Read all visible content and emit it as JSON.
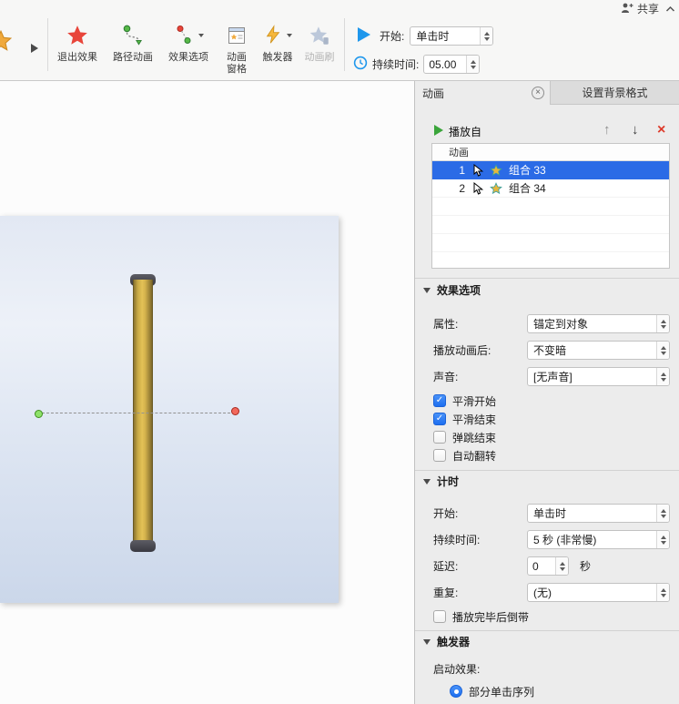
{
  "titlebar": {
    "share": "共享"
  },
  "ribbon": {
    "buttons": {
      "exit_effect": "退出效果",
      "path_animation": "路径动画",
      "effect_options": "效果选项",
      "animation_pane_line1": "动画",
      "animation_pane_line2": "窗格",
      "trigger": "触发器",
      "animation_painter": "动画刷"
    },
    "start_label": "开始:",
    "start_value": "单击时",
    "duration_label": "持续时间:",
    "duration_value": "05.00"
  },
  "panel": {
    "tab_animation": "动画",
    "tab_background": "设置背景格式",
    "play_from": "播放自",
    "list_header": "动画",
    "rows": [
      {
        "index": "1",
        "label": "组合 33",
        "selected": true
      },
      {
        "index": "2",
        "label": "组合 34",
        "selected": false
      }
    ],
    "effect": {
      "title": "效果选项",
      "property_label": "属性:",
      "property_value": "锚定到对象",
      "after_label": "播放动画后:",
      "after_value": "不变暗",
      "sound_label": "声音:",
      "sound_value": "[无声音]",
      "smooth_start": {
        "label": "平滑开始",
        "checked": true
      },
      "smooth_end": {
        "label": "平滑结束",
        "checked": true
      },
      "bounce_end": {
        "label": "弹跳结束",
        "checked": false
      },
      "auto_reverse": {
        "label": "自动翻转",
        "checked": false
      }
    },
    "timing": {
      "title": "计时",
      "start_label": "开始:",
      "start_value": "单击时",
      "duration_label": "持续时间:",
      "duration_value": "5 秒 (非常慢)",
      "delay_label": "延迟:",
      "delay_value": "0",
      "delay_unit": "秒",
      "repeat_label": "重复:",
      "repeat_value": "(无)",
      "rewind": {
        "label": "播放完毕后倒带",
        "checked": false
      }
    },
    "trigger": {
      "title": "触发器",
      "start_effect_label": "启动效果:",
      "option": {
        "label": "部分单击序列",
        "selected": true
      }
    }
  },
  "colors": {
    "selection_blue": "#2b6be6",
    "accent_blue": "#1f97ec",
    "star_red": "#e8453a",
    "green": "#3ba53b"
  }
}
